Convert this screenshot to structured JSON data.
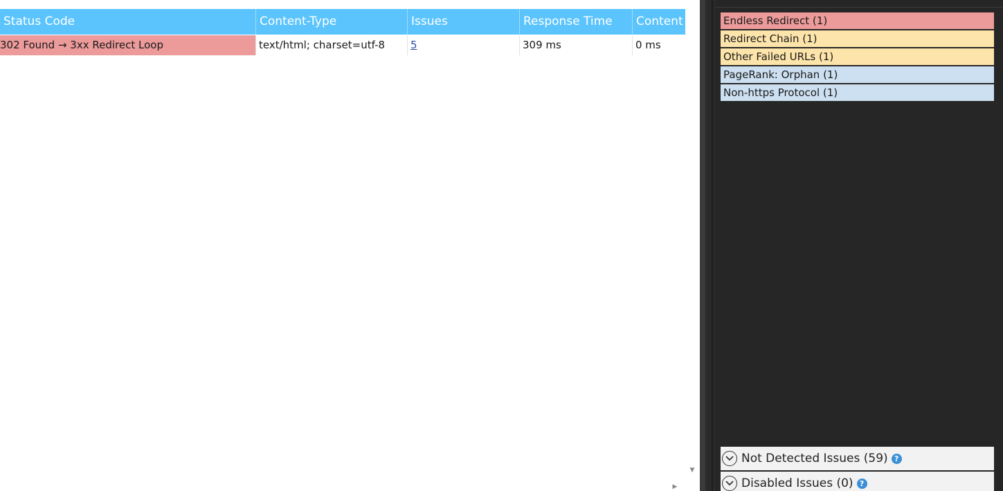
{
  "table": {
    "columns": [
      {
        "key": "status_code",
        "label": "Status Code"
      },
      {
        "key": "content_type",
        "label": "Content-Type"
      },
      {
        "key": "issues",
        "label": "Issues"
      },
      {
        "key": "response_time",
        "label": "Response Time"
      },
      {
        "key": "content",
        "label": "Content"
      }
    ],
    "rows": [
      {
        "status_code": "302 Found → 3xx Redirect Loop",
        "content_type": "text/html; charset=utf-8",
        "issues": "5",
        "response_time": "309 ms",
        "content": "0 ms"
      }
    ]
  },
  "issues_panel": {
    "items": [
      {
        "label": "Endless Redirect (1)",
        "severity": "error",
        "color": "#ec9a9a"
      },
      {
        "label": "Redirect Chain (1)",
        "severity": "warning",
        "color": "#fde4aa"
      },
      {
        "label": "Other Failed URLs (1)",
        "severity": "warning",
        "color": "#fde4aa"
      },
      {
        "label": "PageRank: Orphan (1)",
        "severity": "notice",
        "color": "#cde0f1"
      },
      {
        "label": "Non-https Protocol (1)",
        "severity": "notice",
        "color": "#cde0f1"
      }
    ],
    "not_detected": {
      "label": "Not Detected Issues (59)",
      "icon": "chevron-down-icon",
      "help_icon": "help-icon"
    },
    "disabled": {
      "label": "Disabled Issues (0)",
      "icon": "chevron-down-icon",
      "help_icon": "help-icon"
    }
  },
  "colors": {
    "header_bg": "#5bc4fd",
    "error_bg": "#ec9a9a",
    "warning_bg": "#fde4aa",
    "notice_bg": "#cde0f1",
    "panel_bg": "#262626",
    "link": "#2a4fa8"
  }
}
